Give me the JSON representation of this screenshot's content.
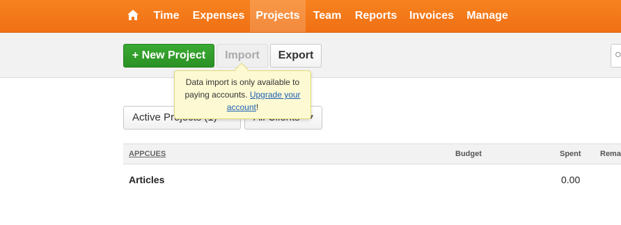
{
  "nav": {
    "items": [
      {
        "label": "Time"
      },
      {
        "label": "Expenses"
      },
      {
        "label": "Projects"
      },
      {
        "label": "Team"
      },
      {
        "label": "Reports"
      },
      {
        "label": "Invoices"
      },
      {
        "label": "Manage"
      }
    ],
    "active": "Projects",
    "home_icon": "home-icon"
  },
  "toolbar": {
    "new_project_label": "New Project",
    "import_label": "Import",
    "export_label": "Export"
  },
  "tooltip": {
    "text_before": "Data import is only available to paying accounts. ",
    "link_text": "Upgrade your account",
    "text_after": "!"
  },
  "filters": {
    "active_projects": "Active Projects (1)",
    "all_clients": "All Clients"
  },
  "table": {
    "client_header": "APPCUES",
    "columns": {
      "budget": "Budget",
      "spent": "Spent",
      "remaining": "Remai"
    },
    "rows": [
      {
        "project": "Articles",
        "budget": "",
        "spent": "0.00"
      }
    ]
  },
  "colors": {
    "brand_orange": "#f57b1c",
    "new_button_green": "#2f9b28",
    "tooltip_bg": "#fdf9d3"
  }
}
